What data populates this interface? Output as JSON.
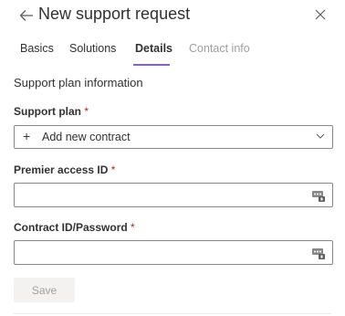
{
  "header": {
    "title": "New support request",
    "back_icon": "arrow-left-icon",
    "close_icon": "close-icon"
  },
  "tabs": [
    {
      "label": "Basics",
      "state": "normal"
    },
    {
      "label": "Solutions",
      "state": "normal"
    },
    {
      "label": "Details",
      "state": "active"
    },
    {
      "label": "Contact info",
      "state": "disabled"
    }
  ],
  "section": {
    "title": "Support plan information"
  },
  "fields": {
    "support_plan": {
      "label": "Support plan",
      "required_mark": "*",
      "selected": "Add new contract",
      "icon": "plus-icon"
    },
    "premier_access_id": {
      "label": "Premier access ID",
      "required_mark": "*",
      "value": "",
      "icon": "password-manager-icon"
    },
    "contract_password": {
      "label": "Contract ID/Password",
      "required_mark": "*",
      "value": "",
      "icon": "password-manager-icon"
    }
  },
  "actions": {
    "save_label": "Save",
    "save_enabled": false
  },
  "colors": {
    "accent": "#8764b8",
    "required": "#a4262c",
    "disabled_text": "#a19f9d",
    "border": "#8a8886"
  }
}
